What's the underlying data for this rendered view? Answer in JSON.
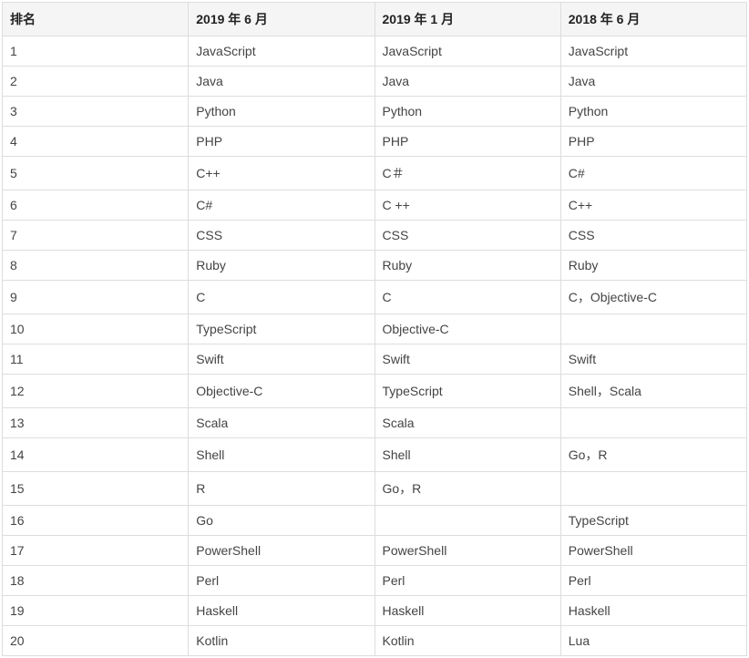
{
  "chart_data": {
    "type": "table",
    "headers": [
      "排名",
      "2019 年 6 月",
      "2019 年 1 月",
      "2018 年 6 月"
    ],
    "rows": [
      [
        "1",
        "JavaScript",
        "JavaScript",
        "JavaScript"
      ],
      [
        "2",
        "Java",
        "Java",
        "Java"
      ],
      [
        "3",
        "Python",
        "Python",
        "Python"
      ],
      [
        "4",
        "PHP",
        "PHP",
        "PHP"
      ],
      [
        "5",
        "C++",
        "C＃",
        "C#"
      ],
      [
        "6",
        "C#",
        "C ++",
        "C++"
      ],
      [
        "7",
        "CSS",
        "CSS",
        "CSS"
      ],
      [
        "8",
        "Ruby",
        "Ruby",
        "Ruby"
      ],
      [
        "9",
        "C",
        "C",
        "C，Objective-C"
      ],
      [
        "10",
        "TypeScript",
        "Objective-C",
        ""
      ],
      [
        "11",
        "Swift",
        "Swift",
        "Swift"
      ],
      [
        "12",
        "Objective-C",
        "TypeScript",
        "Shell，Scala"
      ],
      [
        "13",
        "Scala",
        "Scala",
        ""
      ],
      [
        "14",
        "Shell",
        "Shell",
        "Go，R"
      ],
      [
        "15",
        "R",
        "Go，R",
        ""
      ],
      [
        "16",
        "Go",
        "",
        "TypeScript"
      ],
      [
        "17",
        "PowerShell",
        "PowerShell",
        "PowerShell"
      ],
      [
        "18",
        "Perl",
        "Perl",
        "Perl"
      ],
      [
        "19",
        "Haskell",
        "Haskell",
        "Haskell"
      ],
      [
        "20",
        "Kotlin",
        "Kotlin",
        "Lua"
      ]
    ]
  }
}
